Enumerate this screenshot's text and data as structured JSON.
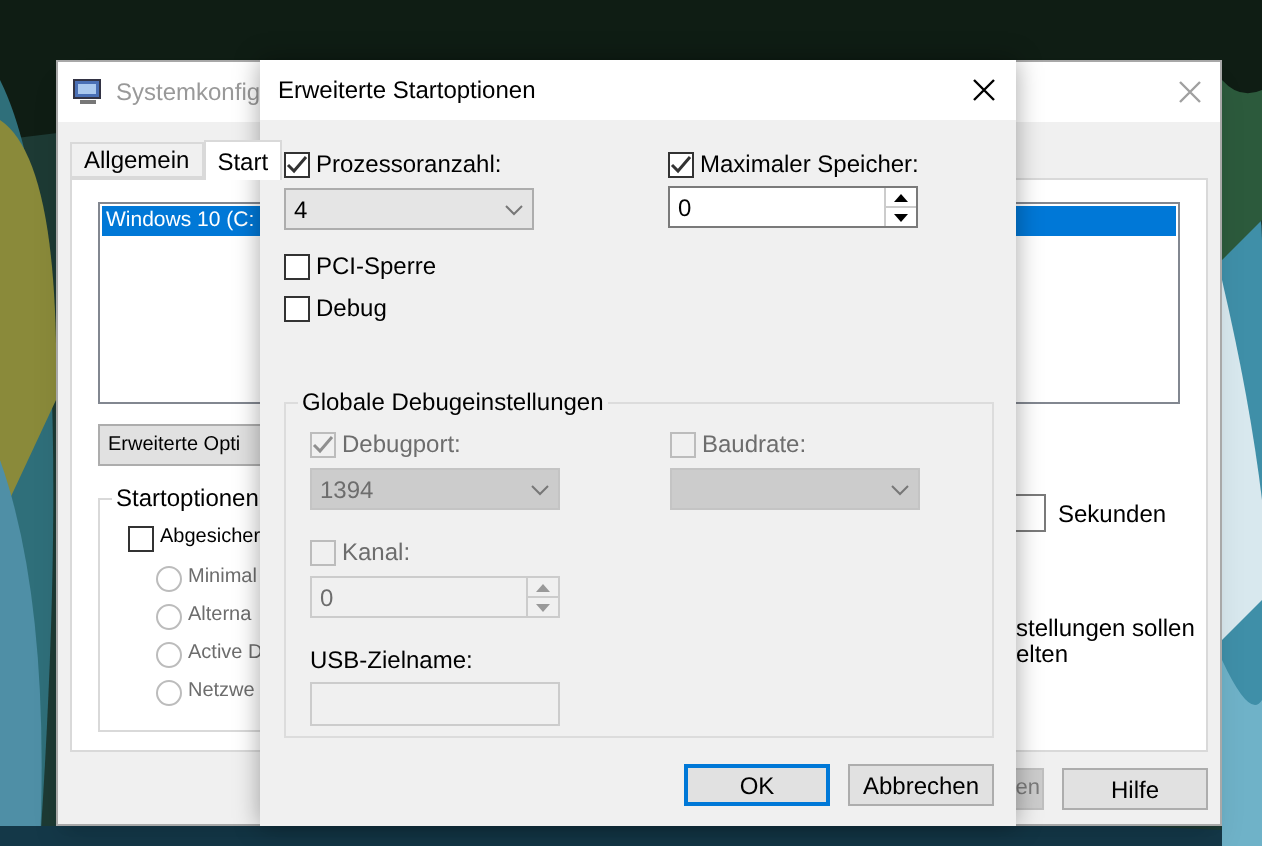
{
  "background_window": {
    "title": "Systemkonfig",
    "tabs": [
      {
        "label": "Allgemein",
        "selected": false
      },
      {
        "label": "Start",
        "selected": true
      }
    ],
    "boot_list": [
      {
        "label": "Windows 10 (C:",
        "selected": true
      }
    ],
    "advanced_button": "Erweiterte Opti",
    "boot_options": {
      "title": "Startoptionen",
      "safe_boot": {
        "label": "Abgesicher",
        "checked": false
      },
      "modes": [
        {
          "label": "Minimal",
          "selected": false,
          "disabled": true
        },
        {
          "label": "Alterna",
          "selected": false,
          "disabled": true
        },
        {
          "label": "Active D",
          "selected": false,
          "disabled": true
        },
        {
          "label": "Netzwe",
          "selected": false,
          "disabled": true
        }
      ]
    },
    "timeout_unit": "Sekunden",
    "note": "stellungen sollen\nelten",
    "buttons": [
      {
        "label": "en",
        "disabled": true
      },
      {
        "label": "Hilfe",
        "disabled": false
      }
    ]
  },
  "dialog": {
    "title": "Erweiterte Startoptionen",
    "processor_count": {
      "label": "Prozessoranzahl:",
      "checked": true,
      "value": "4"
    },
    "max_memory": {
      "label": "Maximaler Speicher:",
      "checked": true,
      "value": "0"
    },
    "pci_lock": {
      "label": "PCI-Sperre",
      "checked": false
    },
    "debug": {
      "label": "Debug",
      "checked": false
    },
    "debug_settings": {
      "title": "Globale Debugeinstellungen",
      "debug_port": {
        "label": "Debugport:",
        "checked": true,
        "disabled": true,
        "value": "1394"
      },
      "baud_rate": {
        "label": "Baudrate:",
        "checked": false,
        "disabled": true
      },
      "channel": {
        "label": "Kanal:",
        "checked": false,
        "disabled": true,
        "value": "0"
      },
      "usb_target": {
        "label": "USB-Zielname:",
        "disabled": true
      }
    },
    "buttons": [
      {
        "label": "OK",
        "default": true
      },
      {
        "label": "Abbrechen",
        "default": false
      }
    ]
  }
}
